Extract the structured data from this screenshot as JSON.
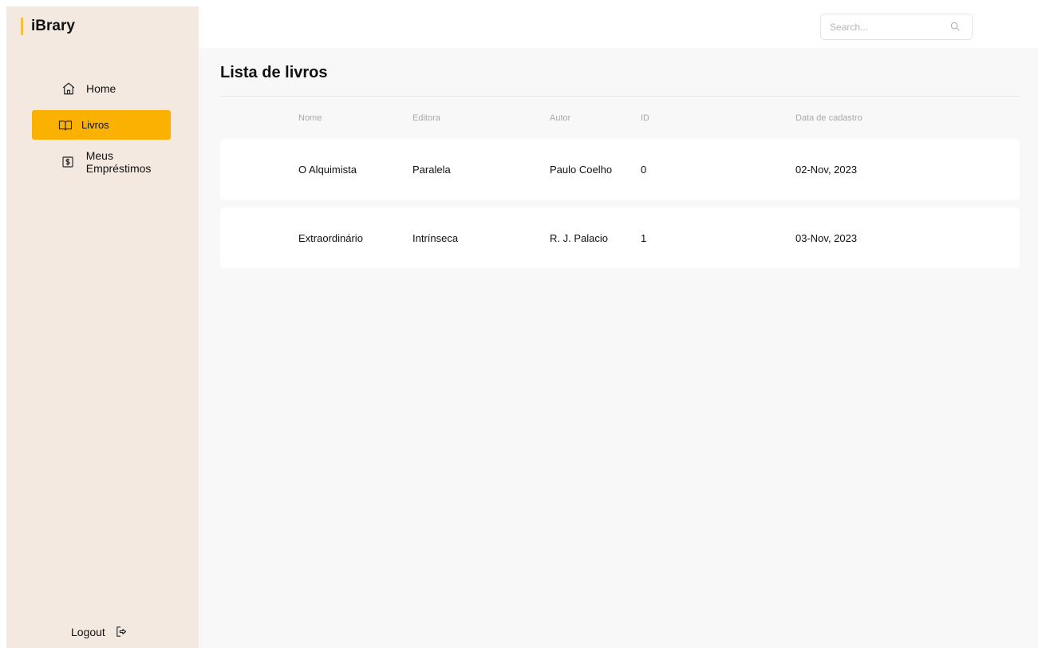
{
  "brand": {
    "name": "iBrary",
    "accent": "#f5c13b"
  },
  "sidebar": {
    "items": [
      {
        "label": "Home",
        "icon": "home-icon",
        "active": false
      },
      {
        "label": "Livros",
        "icon": "book-open-icon",
        "active": true
      },
      {
        "label": "Meus Empréstimos",
        "icon": "dollar-icon",
        "active": false
      }
    ],
    "logout_label": "Logout",
    "active_color": "#fbb101",
    "background": "#f3e9e0"
  },
  "search": {
    "placeholder": "Search..."
  },
  "main": {
    "title": "Lista de livros",
    "columns": {
      "nome": "Nome",
      "editora": "Editora",
      "autor": "Autor",
      "id": "ID",
      "data": "Data de cadastro"
    },
    "rows": [
      {
        "nome": "O Alquimista",
        "editora": "Paralela",
        "autor": "Paulo Coelho",
        "id": "0",
        "data": "02-Nov, 2023"
      },
      {
        "nome": "Extraordinário",
        "editora": "Intrínseca",
        "autor": "R. J. Palacio",
        "id": "1",
        "data": "03-Nov, 2023"
      }
    ]
  }
}
